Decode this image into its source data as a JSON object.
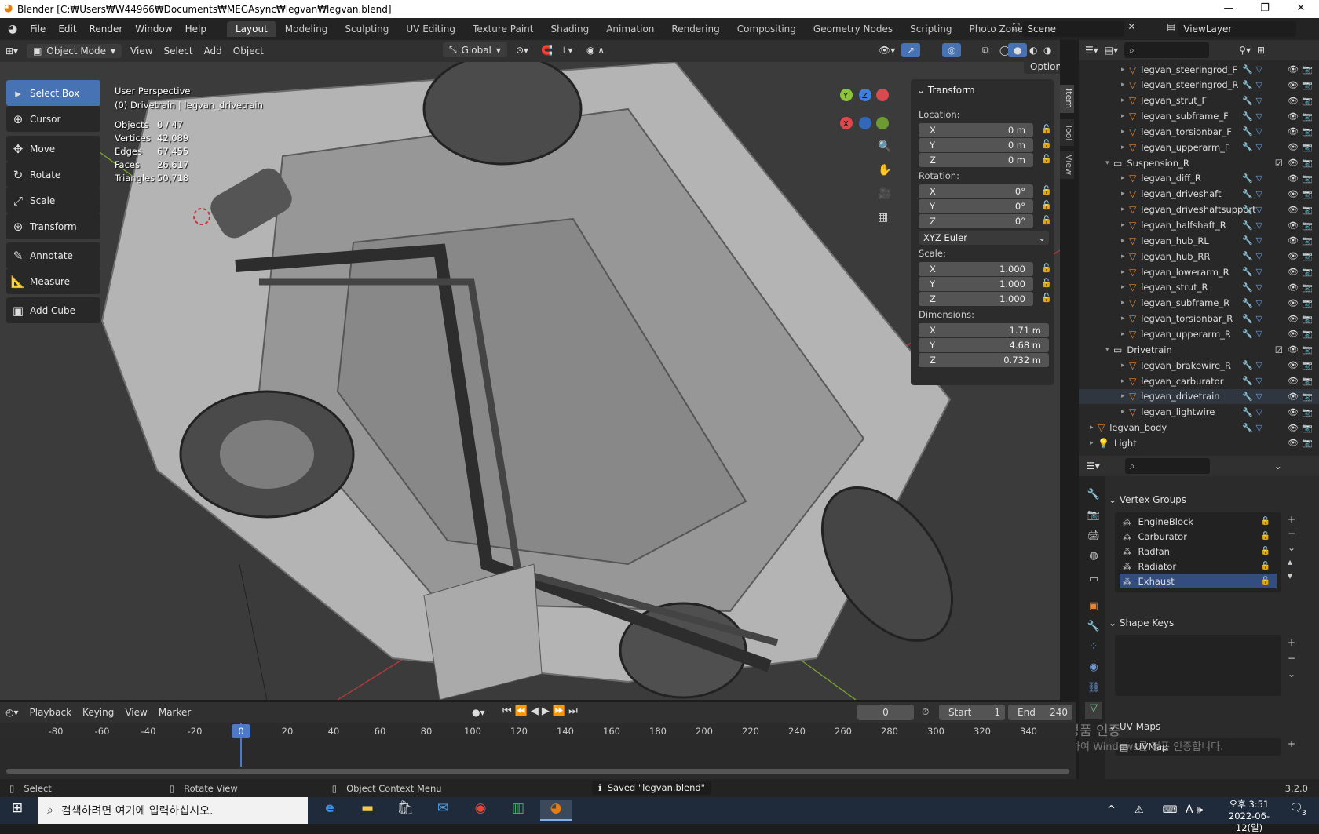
{
  "window": {
    "title": "Blender [C:₩Users₩W44966₩Documents₩MEGAsync₩legvan₩legvan.blend]"
  },
  "menus": [
    "File",
    "Edit",
    "Render",
    "Window",
    "Help"
  ],
  "workspaces": [
    "Layout",
    "Modeling",
    "Sculpting",
    "UV Editing",
    "Texture Paint",
    "Shading",
    "Animation",
    "Rendering",
    "Compositing",
    "Geometry Nodes",
    "Scripting",
    "Photo Zone"
  ],
  "scene": "Scene",
  "viewlayer": "ViewLayer",
  "vpheader": {
    "mode": "Object Mode",
    "view": "View",
    "select": "Select",
    "add": "Add",
    "object": "Object",
    "orientation": "Global",
    "options": "Options"
  },
  "tools": [
    "Select Box",
    "Cursor",
    "Move",
    "Rotate",
    "Scale",
    "Transform",
    "Annotate",
    "Measure",
    "Add Cube"
  ],
  "overlay": {
    "title": "User Perspective",
    "subtitle": "(0) Drivetrain | legvan_drivetrain",
    "stats": [
      [
        "Objects",
        "0 / 47"
      ],
      [
        "Vertices",
        "42,089"
      ],
      [
        "Edges",
        "67,455"
      ],
      [
        "Faces",
        "26,617"
      ],
      [
        "Triangles",
        "50,718"
      ]
    ]
  },
  "npanel": {
    "title": "Transform",
    "location_lbl": "Location:",
    "rotation_lbl": "Rotation:",
    "scale_lbl": "Scale:",
    "dimensions_lbl": "Dimensions:",
    "location": [
      "0 m",
      "0 m",
      "0 m"
    ],
    "rotation": [
      "0°",
      "0°",
      "0°"
    ],
    "euler": "XYZ Euler",
    "scale": [
      "1.000",
      "1.000",
      "1.000"
    ],
    "dimensions": [
      "1.71 m",
      "4.68 m",
      "0.732 m"
    ],
    "tabs": [
      "Item",
      "Tool",
      "View"
    ]
  },
  "outliner": [
    {
      "name": "legvan_steeringrod_F",
      "indent": 2,
      "type": "obj"
    },
    {
      "name": "legvan_steeringrod_R",
      "indent": 2,
      "type": "obj"
    },
    {
      "name": "legvan_strut_F",
      "indent": 2,
      "type": "obj"
    },
    {
      "name": "legvan_subframe_F",
      "indent": 2,
      "type": "obj"
    },
    {
      "name": "legvan_torsionbar_F",
      "indent": 2,
      "type": "obj"
    },
    {
      "name": "legvan_upperarm_F",
      "indent": 2,
      "type": "obj"
    },
    {
      "name": "Suspension_R",
      "indent": 1,
      "type": "col"
    },
    {
      "name": "legvan_diff_R",
      "indent": 2,
      "type": "obj"
    },
    {
      "name": "legvan_driveshaft",
      "indent": 2,
      "type": "obj"
    },
    {
      "name": "legvan_driveshaftsupport",
      "indent": 2,
      "type": "obj"
    },
    {
      "name": "legvan_halfshaft_R",
      "indent": 2,
      "type": "obj"
    },
    {
      "name": "legvan_hub_RL",
      "indent": 2,
      "type": "obj"
    },
    {
      "name": "legvan_hub_RR",
      "indent": 2,
      "type": "obj"
    },
    {
      "name": "legvan_lowerarm_R",
      "indent": 2,
      "type": "obj"
    },
    {
      "name": "legvan_strut_R",
      "indent": 2,
      "type": "obj"
    },
    {
      "name": "legvan_subframe_R",
      "indent": 2,
      "type": "obj"
    },
    {
      "name": "legvan_torsionbar_R",
      "indent": 2,
      "type": "obj"
    },
    {
      "name": "legvan_upperarm_R",
      "indent": 2,
      "type": "obj"
    },
    {
      "name": "Drivetrain",
      "indent": 1,
      "type": "col"
    },
    {
      "name": "legvan_brakewire_R",
      "indent": 2,
      "type": "obj"
    },
    {
      "name": "legvan_carburator",
      "indent": 2,
      "type": "obj"
    },
    {
      "name": "legvan_drivetrain",
      "indent": 2,
      "type": "obj"
    },
    {
      "name": "legvan_lightwire",
      "indent": 2,
      "type": "obj"
    },
    {
      "name": "legvan_body",
      "indent": 0,
      "type": "obj"
    },
    {
      "name": "Light",
      "indent": 0,
      "type": "light"
    }
  ],
  "props": {
    "vertex_groups_title": "Vertex Groups",
    "vertex_groups": [
      "EngineBlock",
      "Carburator",
      "Radfan",
      "Radiator",
      "Exhaust"
    ],
    "shape_keys_title": "Shape Keys",
    "uvmaps_title": "UV Maps",
    "uvmap": "UVMap"
  },
  "timeline": {
    "playback": "Playback",
    "keying": "Keying",
    "view": "View",
    "marker": "Marker",
    "current": "0",
    "start_lbl": "Start",
    "start": "1",
    "end_lbl": "End",
    "end": "240",
    "ticks": [
      "-80",
      "-60",
      "-40",
      "-20",
      "0",
      "20",
      "40",
      "60",
      "80",
      "100",
      "120",
      "140",
      "160",
      "180",
      "200",
      "220",
      "240",
      "260",
      "280",
      "300",
      "320",
      "340"
    ]
  },
  "status": {
    "select": "Select",
    "rotate": "Rotate View",
    "context": "Object Context Menu",
    "saved": "Saved \"legvan.blend\"",
    "version": "3.2.0"
  },
  "watermark": [
    "Windows 정품 인증",
    "[설정]으로 이동하여 Windows를 정품 인증합니다."
  ],
  "taskbar": {
    "search": "검색하려면 여기에 입력하십시오.",
    "time": "오후 3:51",
    "date": "2022-06-12(일)",
    "lang": "A",
    "notif": "3"
  }
}
